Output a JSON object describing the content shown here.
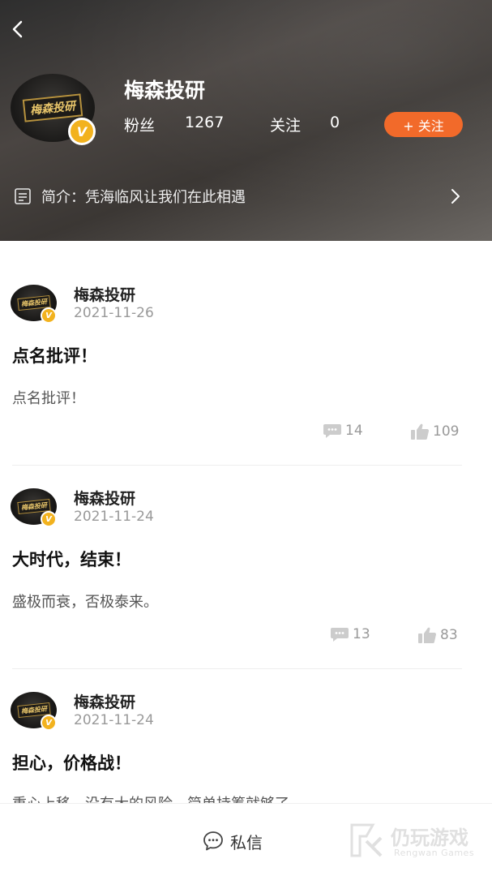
{
  "profile": {
    "name": "梅森投研",
    "avatar_plate": "梅森投研",
    "verified_mark": "V",
    "fans_label": "粉丝",
    "fans_count": "1267",
    "following_label": "关注",
    "following_count": "0",
    "follow_button": "+ 关注",
    "intro_label": "简介：",
    "intro_text": "凭海临风让我们在此相遇"
  },
  "posts": [
    {
      "author": "梅森投研",
      "date": "2021-11-26",
      "title": "点名批评！",
      "body": "点名批评！",
      "comments": "14",
      "likes": "109"
    },
    {
      "author": "梅森投研",
      "date": "2021-11-24",
      "title": "大时代，结束！",
      "body": "盛极而衰，否极泰来。",
      "comments": "13",
      "likes": "83"
    },
    {
      "author": "梅森投研",
      "date": "2021-11-24",
      "title": "担心，价格战！",
      "body": "重心上移，没有大的风险，简单持筹就够了。"
    }
  ],
  "bottom_bar": {
    "dm_label": "私信"
  },
  "watermark": {
    "name": "仍玩游戏",
    "sub": "Rengwan Games"
  },
  "colors": {
    "accent": "#f26a2a",
    "verified": "#f2b21e"
  }
}
